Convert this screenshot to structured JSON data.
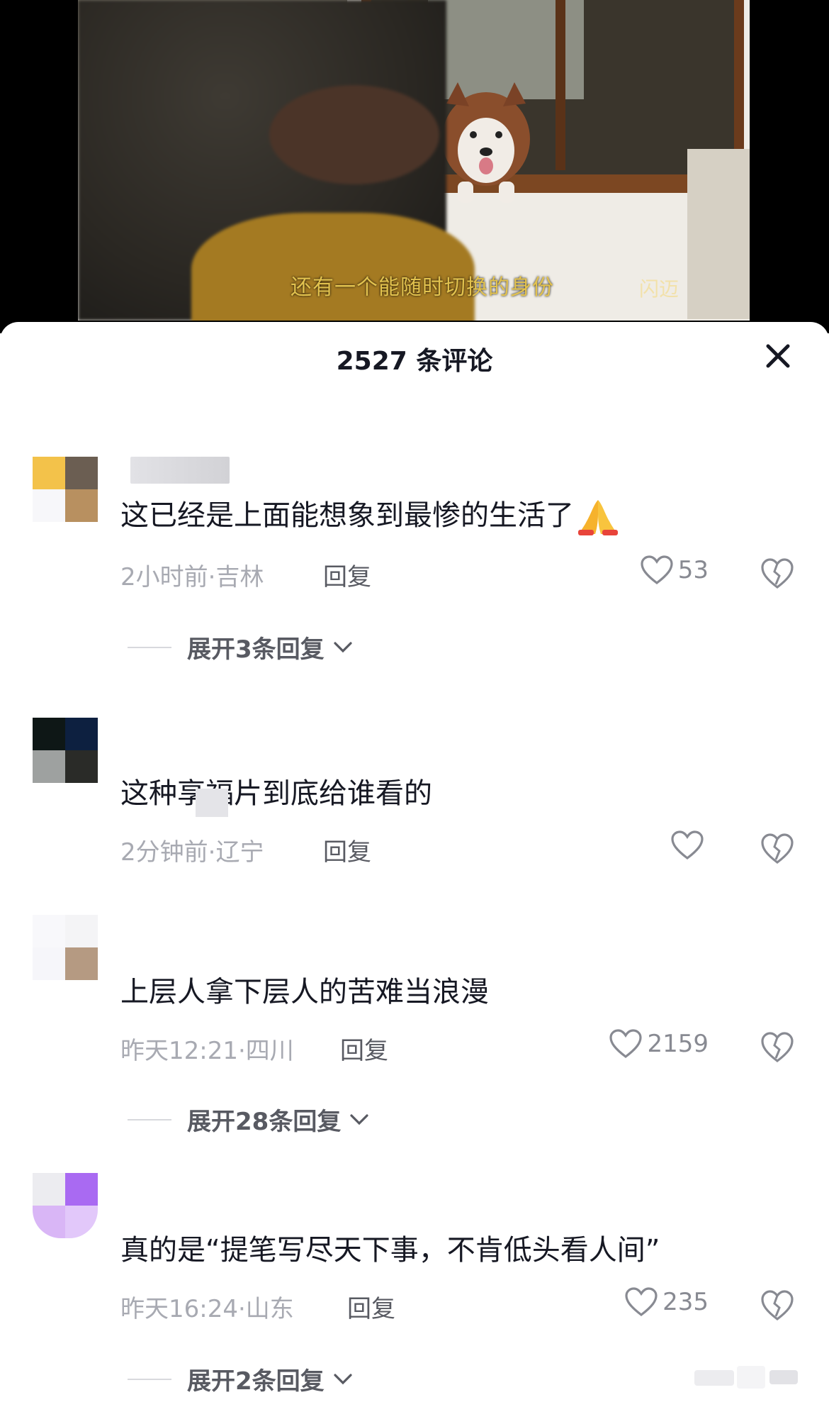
{
  "video": {
    "subtitle": "还有一个能随时切换的身份",
    "watermark": "闪迈"
  },
  "sheet": {
    "title": "2527 条评论",
    "close_icon": "close-icon"
  },
  "comments": [
    {
      "text": "这已经是上面能想象到最惨的生活了",
      "emoji": "folded-hands-icon",
      "time_location": "2小时前·吉林",
      "reply_label": "回复",
      "likes": "53",
      "expand_label": "展开3条回复"
    },
    {
      "text": "这种享福片到底给谁看的",
      "time_location": "2分钟前·辽宁",
      "reply_label": "回复",
      "likes": ""
    },
    {
      "text": "上层人拿下层人的苦难当浪漫",
      "time_location": "昨天12:21·四川",
      "reply_label": "回复",
      "likes": "2159",
      "expand_label": "展开28条回复"
    },
    {
      "text": "真的是“提笔写尽天下事，不肯低头看人间”",
      "time_location": "昨天16:24·山东",
      "reply_label": "回复",
      "likes": "235",
      "expand_label": "展开2条回复"
    }
  ],
  "colors": {
    "text": "#161823",
    "meta": "#a8aab2",
    "subtitle": "#e2c24e"
  }
}
